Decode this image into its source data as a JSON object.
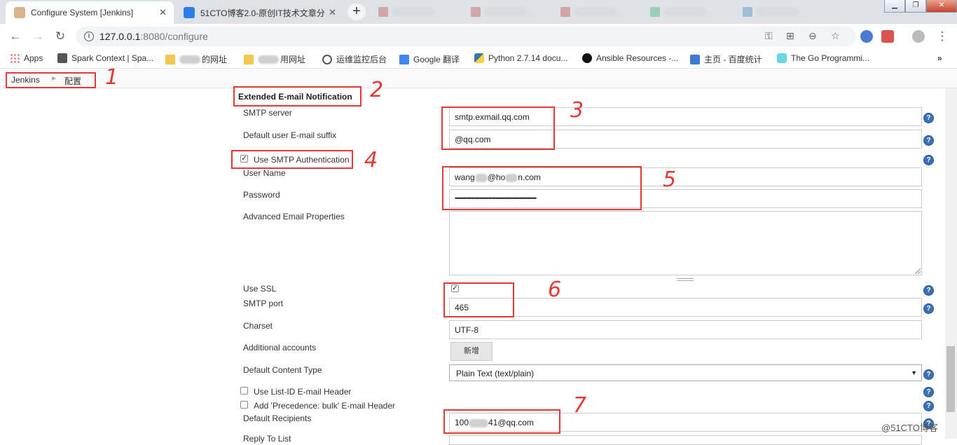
{
  "browser": {
    "tabs": [
      {
        "title": "Configure System [Jenkins]",
        "active": true
      },
      {
        "title": "51CTO博客2.0-原创IT技术文章分",
        "active": false
      }
    ],
    "url_host": "127.0.0.1",
    "url_path": ":8080/configure",
    "bookmarks": [
      {
        "label": "Apps",
        "icon": "apps-grid-icon"
      },
      {
        "label": "Spark Context | Spa...",
        "icon": "book-icon"
      },
      {
        "label": "的网址",
        "icon": "folder-icon"
      },
      {
        "label": "用网址",
        "icon": "folder-icon"
      },
      {
        "label": "运维监控后台",
        "icon": "globe-icon"
      },
      {
        "label": "Google 翻译",
        "icon": "translate-icon"
      },
      {
        "label": "Python 2.7.14 docu...",
        "icon": "python-icon"
      },
      {
        "label": "Ansible Resources -...",
        "icon": "ansible-icon"
      },
      {
        "label": "主页 - 百度统计",
        "icon": "chart-icon"
      },
      {
        "label": "The Go Programmi...",
        "icon": "gopher-icon"
      }
    ],
    "more_bookmarks": "»"
  },
  "breadcrumb": {
    "root": "Jenkins",
    "current": "配置"
  },
  "section_title": "Extended E-mail Notification",
  "form": {
    "smtp_server_label": "SMTP server",
    "smtp_server_value": "smtp.exmail.qq.com",
    "suffix_label": "Default user E-mail suffix",
    "suffix_value": "@qq.com",
    "use_smtp_auth_label": "Use SMTP Authentication",
    "username_label": "User Name",
    "username_part1": "wang",
    "username_part2": "@ho",
    "username_part3": "n.com",
    "password_label": "Password",
    "password_value": "••••••••••••••••••••••••••••••••••••••••••••••••••••••",
    "advanced_label": "Advanced Email Properties",
    "use_ssl_label": "Use SSL",
    "smtp_port_label": "SMTP port",
    "smtp_port_value": "465",
    "charset_label": "Charset",
    "charset_value": "UTF-8",
    "additional_label": "Additional accounts",
    "add_button": "新增",
    "content_type_label": "Default Content Type",
    "content_type_value": "Plain Text (text/plain)",
    "list_id_label": "Use List-ID E-mail Header",
    "precedence_label": "Add 'Precedence: bulk' E-mail Header",
    "recipients_label": "Default Recipients",
    "recipients_part1": "100",
    "recipients_part2": "41@qq.com",
    "reply_to_label": "Reply To List"
  },
  "annotations": [
    "1",
    "2",
    "3",
    "4",
    "5",
    "6",
    "7"
  ],
  "watermark": "@51CTO博客",
  "colors": {
    "annotation": "#e53935",
    "help": "#3b6fb6"
  }
}
